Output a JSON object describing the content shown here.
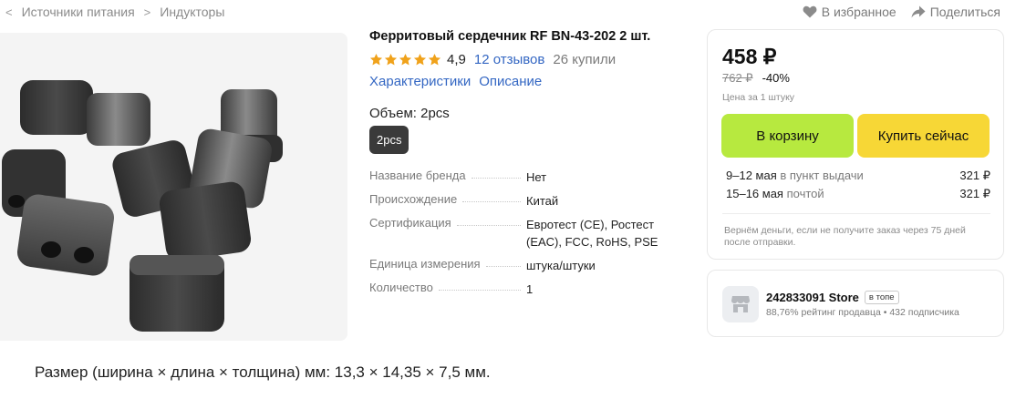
{
  "breadcrumb": [
    "Источники питания",
    "Индукторы"
  ],
  "top_actions": {
    "favorite": "В избранное",
    "share": "Поделиться"
  },
  "product": {
    "title": "Ферритовый сердечник RF BN-43-202 2 шт.",
    "rating": "4,9",
    "stars": 5,
    "reviews": "12 отзывов",
    "bought": "26 купили",
    "tabs": [
      "Характеристики",
      "Описание"
    ],
    "volume_label": "Объем: 2pcs",
    "selected_option": "2pcs"
  },
  "specs": [
    {
      "key": "Название бренда",
      "value": "Нет"
    },
    {
      "key": "Происхождение",
      "value": "Китай"
    },
    {
      "key": "Сертификация",
      "value": "Евротест (CE), Ростест (EAC), FCC, RoHS, PSE"
    },
    {
      "key": "Единица измерения",
      "value": "штука/штуки"
    },
    {
      "key": "Количество",
      "value": "1"
    }
  ],
  "price": {
    "current": "458 ₽",
    "old": "762 ₽",
    "discount": "-40%",
    "unit_note": "Цена за 1 штуку",
    "cart_button": "В корзину",
    "buy_button": "Купить сейчас",
    "delivery": [
      {
        "date": "9–12 мая",
        "type": " в пункт выдачи",
        "price": "321 ₽"
      },
      {
        "date": "15–16 мая",
        "type": " почтой",
        "price": "321 ₽"
      }
    ],
    "refund_note": "Вернём деньги, если не получите заказ через 75 дней после отправки."
  },
  "seller": {
    "name": "242833091 Store",
    "badge": "в топе",
    "meta": "88,76% рейтинг продавца • 432 подписчика"
  },
  "description": {
    "size_line": "Размер (ширина × длина × толщина) мм: 13,3 × 14,35 × 7,5 мм."
  },
  "colors": {
    "link": "#3467c3",
    "star": "#f0a21b",
    "cart_button": "#b7e93f",
    "buy_button": "#f7d736"
  }
}
